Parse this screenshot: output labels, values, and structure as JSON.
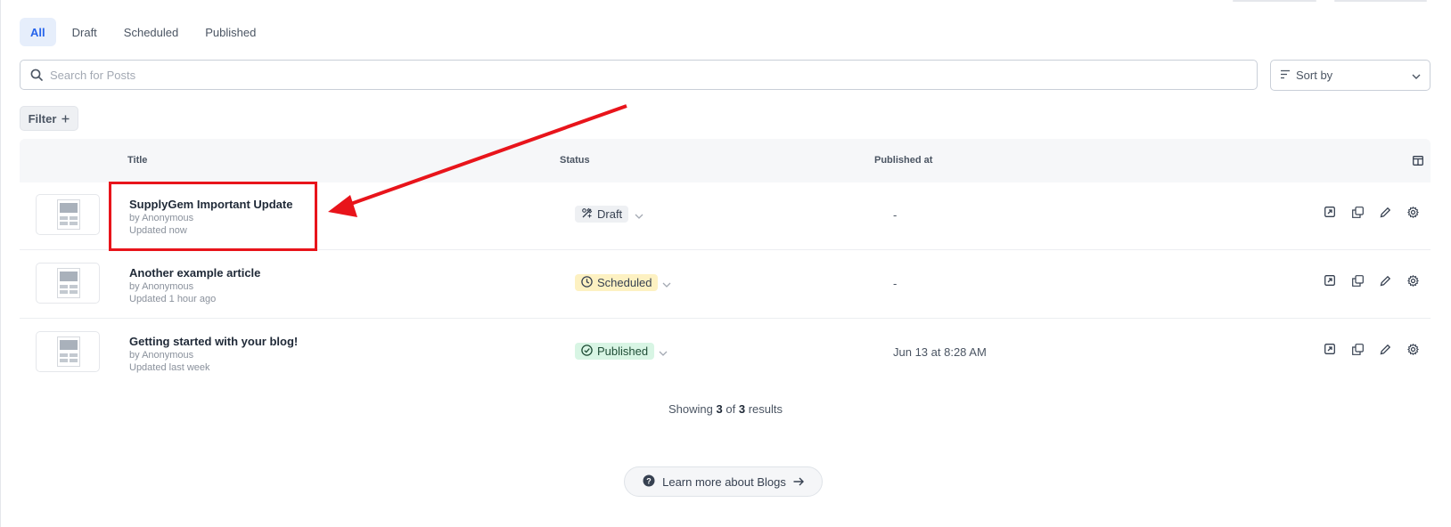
{
  "tabs": [
    {
      "label": "All",
      "active": true
    },
    {
      "label": "Draft",
      "active": false
    },
    {
      "label": "Scheduled",
      "active": false
    },
    {
      "label": "Published",
      "active": false
    }
  ],
  "search": {
    "placeholder": "Search for Posts",
    "icon": "search-icon"
  },
  "sort": {
    "label": "Sort by"
  },
  "filter": {
    "label": "Filter"
  },
  "table": {
    "headers": {
      "title": "Title",
      "status": "Status",
      "published_at": "Published at"
    },
    "rows": [
      {
        "title": "SupplyGem Important Update",
        "author": "by Anonymous",
        "updated": "Updated now",
        "status": "Draft",
        "published_at": "-"
      },
      {
        "title": "Another example article",
        "author": "by Anonymous",
        "updated": "Updated 1 hour ago",
        "status": "Scheduled",
        "published_at": "-"
      },
      {
        "title": "Getting started with your blog!",
        "author": "by Anonymous",
        "updated": "Updated last week",
        "status": "Published",
        "published_at": "Jun 13 at 8:28 AM"
      }
    ]
  },
  "footer": {
    "showing_pre": "Showing",
    "shown": "3",
    "of": "of",
    "total": "3",
    "results": "results"
  },
  "learn_more": {
    "label": "Learn more about Blogs"
  },
  "colors": {
    "accent": "#2563eb",
    "annotation": "#e8141b",
    "scheduled_bg": "#fdf1c2",
    "published_bg": "#d8f5e4"
  }
}
